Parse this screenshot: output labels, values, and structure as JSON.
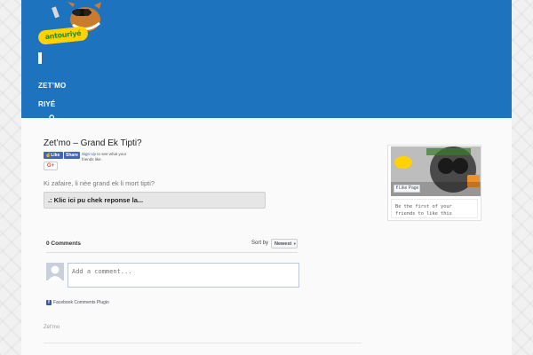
{
  "header": {
    "logo_text": "antouriyé",
    "nav": [
      {
        "label": "ZET’MO"
      },
      {
        "label": "RIYÉ"
      }
    ]
  },
  "post": {
    "title": "Zet’mo – Grand Ek Tipti?",
    "question": "Ki zafaire, li nèe grand ek li mort tipti?",
    "answer_button": ".: Klic ici pu chek reponse la...",
    "category": "Zet'mo"
  },
  "social": {
    "like_label": "Like",
    "share_label": "Share",
    "signup_link": "Sign Up",
    "signup_text": " to see what your friends like.",
    "gplus_label": "G+"
  },
  "comments": {
    "count_label": "0 Comments",
    "sort_label": "Sort by",
    "sort_value": "Newest",
    "input_placeholder": "Add a comment...",
    "plugin_label": "Facebook Comments Plugin"
  },
  "sidebar": {
    "like_page_label": "Like Page",
    "first_friends_text": "Be the first of your friends to like this"
  },
  "colors": {
    "header_bg": "#1e73be",
    "facebook_blue": "#4267b2"
  },
  "icons": [
    "logo-mascot",
    "menu-toggle-icon",
    "search-icon",
    "facebook-icon",
    "avatar-silhouette"
  ]
}
